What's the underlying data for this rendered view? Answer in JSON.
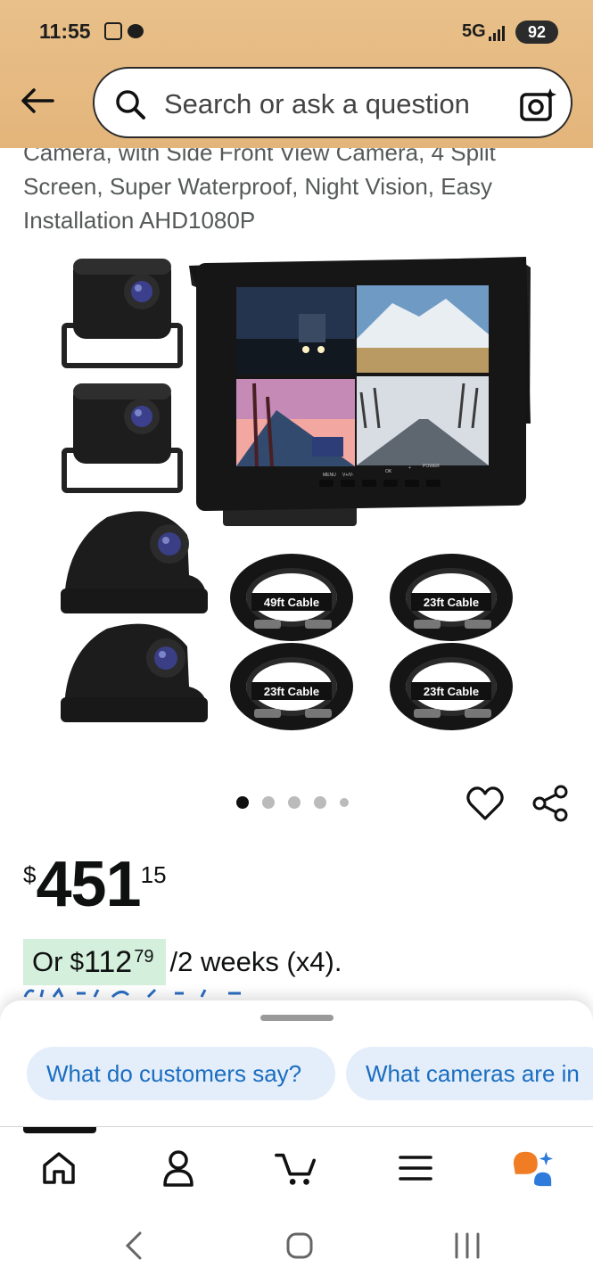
{
  "status_bar": {
    "time": "11:55",
    "network": "5G",
    "battery": "92"
  },
  "search": {
    "placeholder": "Search or ask a question"
  },
  "product": {
    "title": "Camera, with Side Front View Camera, 4 Split Screen, Super Waterproof, Night Vision, Easy Installation AHD1080P",
    "image_labels": {
      "cable_1": "49ft Cable",
      "cable_2": "23ft Cable",
      "cable_3": "23ft Cable",
      "cable_4": "23ft Cable",
      "monitor_buttons": [
        "MENU",
        "V+/V-",
        "OK",
        "+",
        "POWER"
      ]
    },
    "carousel": {
      "total": 5,
      "active_index": 0
    }
  },
  "price": {
    "symbol": "$",
    "whole": "451",
    "fraction": "15"
  },
  "installment": {
    "prefix": "Or",
    "symbol": "$",
    "whole": "112",
    "fraction": "79",
    "suffix": "/2 weeks (x4)."
  },
  "bottom_sheet": {
    "chips": [
      {
        "label": "What do customers say?"
      },
      {
        "label": "What cameras are in"
      }
    ]
  },
  "bottom_nav": {
    "items": [
      {
        "icon": "home-icon"
      },
      {
        "icon": "account-icon"
      },
      {
        "icon": "cart-icon"
      },
      {
        "icon": "menu-icon"
      },
      {
        "icon": "rufus-assistant-icon"
      }
    ],
    "active": "home-icon"
  },
  "colors": {
    "header": "#e3b57b",
    "price_highlight": "#d4efdc",
    "chip_bg": "#e3eefa",
    "chip_text": "#1b6dc1",
    "assistant_orange": "#f07c24",
    "assistant_blue": "#2f7bdc"
  }
}
